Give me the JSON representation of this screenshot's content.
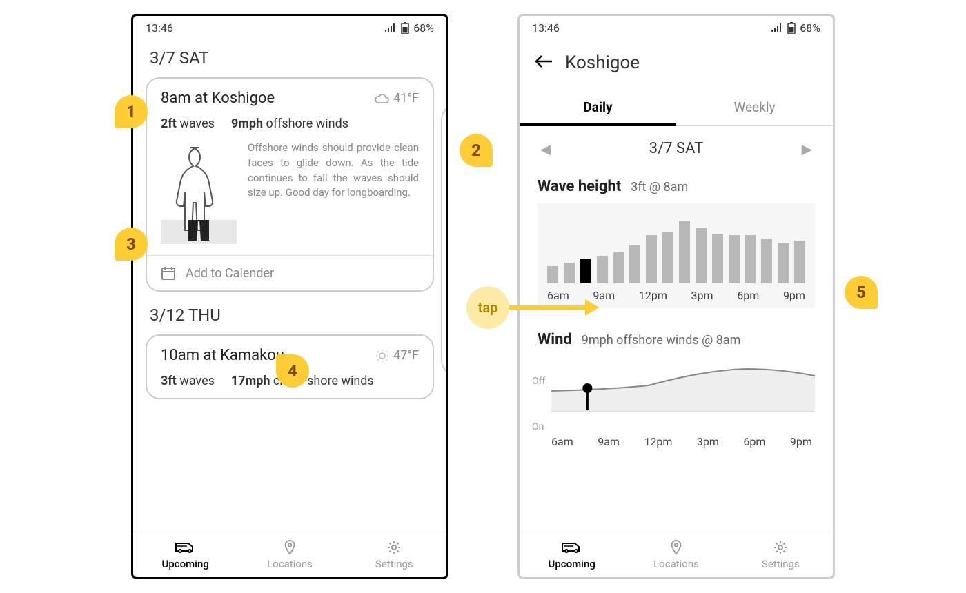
{
  "status": {
    "time": "13:46",
    "battery": "68%"
  },
  "left": {
    "date1": "3/7 SAT",
    "card1": {
      "title": "8am at Koshigoe",
      "temp": "41°F",
      "waves_val": "2ft",
      "waves_lbl": " waves",
      "wind_val": "9mph",
      "wind_lbl": " offshore winds",
      "desc": "Offshore winds should provide clean faces to glide down. As the tide continues to fall the waves should size up. Good day for longboarding.",
      "add_cal": "Add to Calender"
    },
    "date2": "3/12 THU",
    "card2": {
      "title": "10am at Kamakou",
      "temp": "47°F",
      "waves_val": "3ft",
      "waves_lbl": " waves",
      "wind_val": "17mph",
      "wind_lbl": " cross-shore winds"
    }
  },
  "right": {
    "location": "Koshigoe",
    "tabs": {
      "daily": "Daily",
      "weekly": "Weekly"
    },
    "date": "3/7 SAT",
    "wave": {
      "title": "Wave height",
      "sub": "3ft @ 8am"
    },
    "wind": {
      "title": "Wind",
      "sub": "9mph offshore winds @ 8am",
      "off": "Off",
      "on": "On"
    },
    "axis": {
      "t1": "6am",
      "t2": "9am",
      "t3": "12pm",
      "t4": "3pm",
      "t5": "6pm",
      "t6": "9pm"
    }
  },
  "nav": {
    "upcoming": "Upcoming",
    "locations": "Locations",
    "settings": "Settings"
  },
  "annot": {
    "a1": "1",
    "a2": "2",
    "a3": "3",
    "a4": "4",
    "a5": "5",
    "tap": "tap"
  },
  "chart_data": {
    "type": "bar",
    "title": "Wave height",
    "categories": [
      "6am",
      "7am",
      "8am",
      "9am",
      "10am",
      "11am",
      "12pm",
      "1pm",
      "2pm",
      "3pm",
      "4pm",
      "5pm",
      "6pm",
      "7pm",
      "8pm",
      "9pm"
    ],
    "values": [
      25,
      30,
      35,
      40,
      45,
      55,
      70,
      75,
      90,
      80,
      72,
      70,
      70,
      65,
      58,
      62
    ],
    "highlight_index": 2,
    "xlabel": "",
    "ylabel": "",
    "ylim": [
      0,
      100
    ]
  },
  "wind_chart": {
    "type": "line",
    "title": "Wind",
    "x": [
      "6am",
      "7am",
      "8am",
      "9am",
      "10am",
      "11am",
      "12pm",
      "1pm",
      "2pm",
      "3pm",
      "4pm",
      "5pm",
      "6pm",
      "7pm",
      "8pm",
      "9pm"
    ],
    "y_label_top": "Off",
    "y_label_bottom": "On",
    "marker_at": "8am"
  }
}
